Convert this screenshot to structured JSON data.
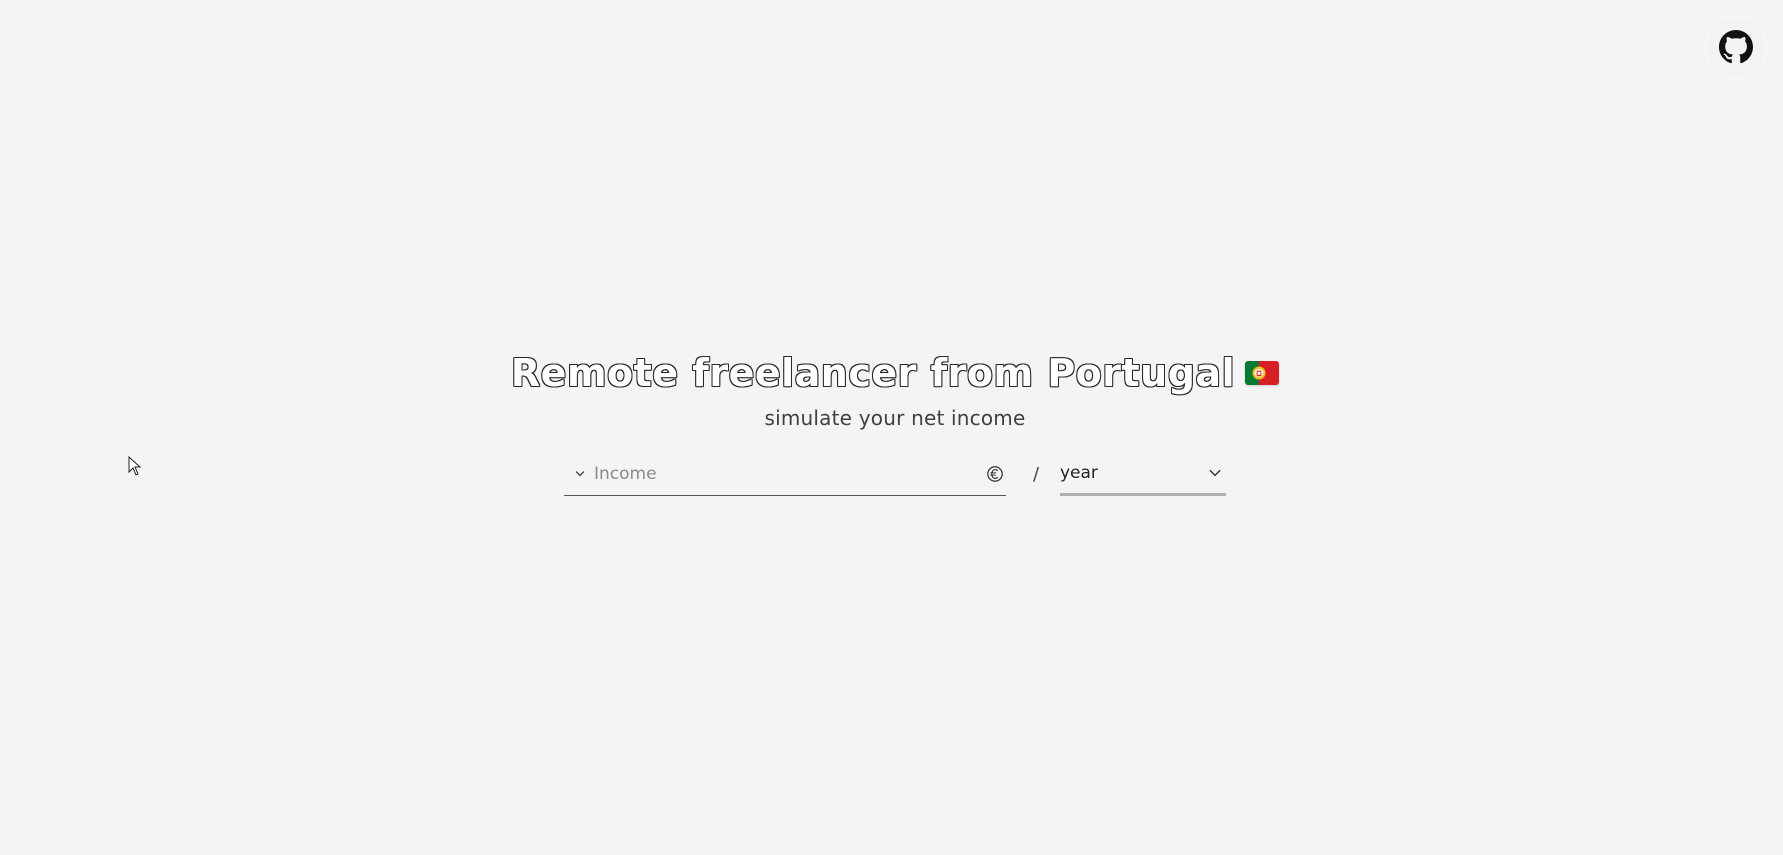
{
  "header": {
    "github_icon": "github-icon"
  },
  "hero": {
    "title": "Remote freelancer from Portugal",
    "flag_icon": "portugal-flag-icon",
    "subtitle": "simulate your net income"
  },
  "form": {
    "income_placeholder": "Income",
    "income_value": "",
    "currency_icon": "euro-icon",
    "separator": "/",
    "period_value": "year"
  }
}
